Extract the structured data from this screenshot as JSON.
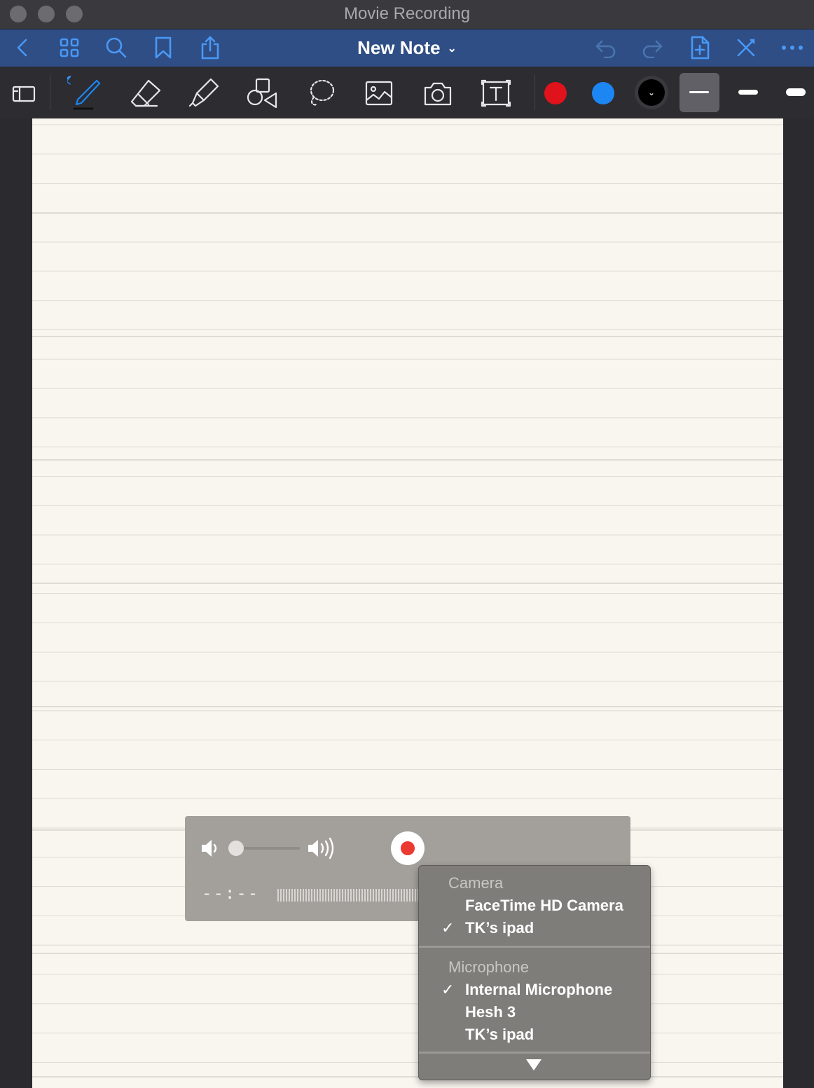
{
  "window": {
    "title": "Movie Recording"
  },
  "navbar": {
    "note_title": "New Note",
    "title_chevron": "⌄"
  },
  "toolbar": {
    "colors": {
      "red": "#e0121b",
      "blue": "#1c86f2",
      "black": "#000000"
    },
    "selected_color_indicator": "⌄"
  },
  "recording_hud": {
    "timecode": "--:--"
  },
  "source_menu": {
    "camera_header": "Camera",
    "camera_options": [
      "FaceTime HD Camera",
      "TK’s ipad"
    ],
    "camera_selected": "TK’s ipad",
    "microphone_header": "Microphone",
    "microphone_options": [
      "Internal Microphone",
      "Hesh 3",
      "TK’s ipad"
    ],
    "microphone_selected": "Internal Microphone",
    "check_glyph": "✓"
  }
}
